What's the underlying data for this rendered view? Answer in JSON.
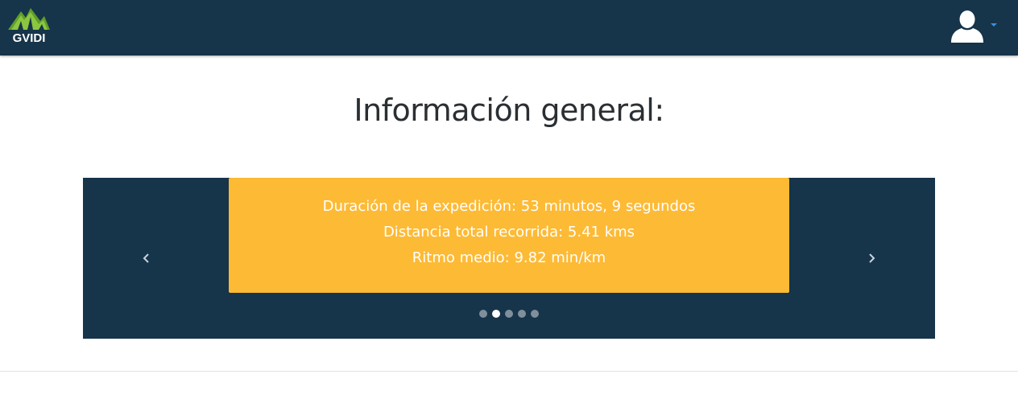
{
  "brand": {
    "name": "GVIDI",
    "logo_icon": "mountain-logo-icon",
    "accent_color": "#8cc63f"
  },
  "navbar": {
    "background_color": "#16344a",
    "user_icon": "user-avatar-icon",
    "caret_icon": "caret-down-icon"
  },
  "page": {
    "title": "Información general:"
  },
  "carousel": {
    "background_color": "#16344a",
    "card_color": "#fdba35",
    "slide": {
      "duration": "Duración de la expedición: 53 minutos, 9 segundos",
      "distance": "Distancia total recorrida: 5.41 kms",
      "pace": "Ritmo medio: 9.82 min/km"
    },
    "prev_icon": "chevron-left-icon",
    "next_icon": "chevron-right-icon",
    "indicator_count": 5,
    "active_indicator": 2
  }
}
